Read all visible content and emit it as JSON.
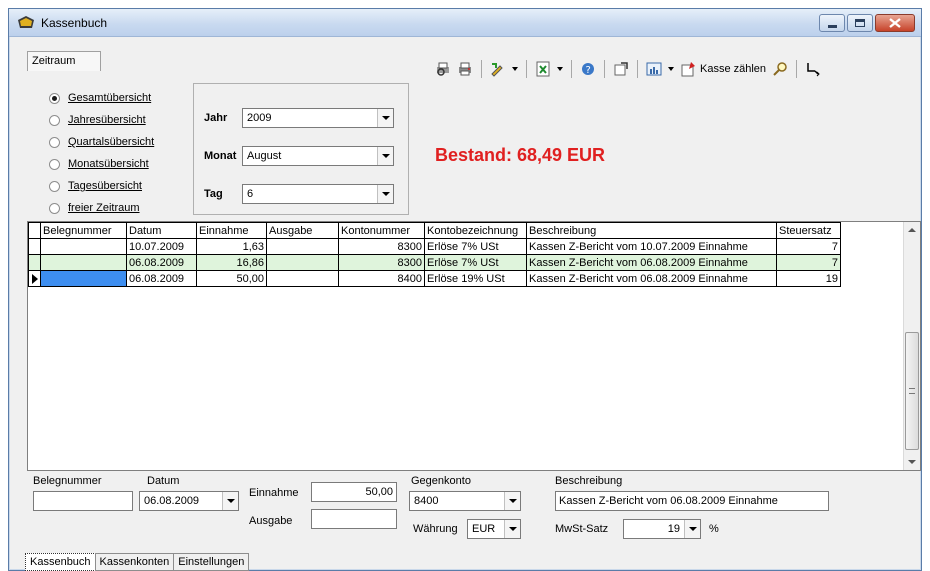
{
  "window": {
    "title": "Kassenbuch"
  },
  "zeitraum_tab": {
    "label": "Zeitraum"
  },
  "overview_options": [
    {
      "label": "Gesamtübersicht",
      "checked": true
    },
    {
      "label": "Jahresübersicht",
      "checked": false
    },
    {
      "label": "Quartalsübersicht",
      "checked": false
    },
    {
      "label": "Monatsübersicht",
      "checked": false
    },
    {
      "label": "Tagesübersicht",
      "checked": false
    },
    {
      "label": "freier Zeitraum",
      "checked": false
    }
  ],
  "selectors": {
    "jahr": {
      "label": "Jahr",
      "value": "2009"
    },
    "monat": {
      "label": "Monat",
      "value": "August"
    },
    "tag": {
      "label": "Tag",
      "value": "6"
    }
  },
  "bestand": {
    "text": "Bestand: 68,49 EUR",
    "color": "#e02020"
  },
  "toolbar": {
    "kasse_zaehlen_label": "Kasse zählen"
  },
  "table": {
    "columns": [
      "Belegnummer",
      "Datum",
      "Einnahme",
      "Ausgabe",
      "Kontonummer",
      "Kontobezeichnung",
      "Beschreibung",
      "Steuersatz"
    ],
    "rows": [
      {
        "belegnummer": "",
        "datum": "10.07.2009",
        "einnahme": "1,63",
        "ausgabe": "",
        "kontonummer": "8300",
        "kontobezeichnung": "Erlöse 7% USt",
        "beschreibung": "Kassen Z-Bericht vom 10.07.2009 Einnahme",
        "steuersatz": "7"
      },
      {
        "belegnummer": "",
        "datum": "06.08.2009",
        "einnahme": "16,86",
        "ausgabe": "",
        "kontonummer": "8300",
        "kontobezeichnung": "Erlöse 7% USt",
        "beschreibung": "Kassen Z-Bericht vom 06.08.2009 Einnahme",
        "steuersatz": "7"
      },
      {
        "belegnummer": "",
        "datum": "06.08.2009",
        "einnahme": "50,00",
        "ausgabe": "",
        "kontonummer": "8400",
        "kontobezeichnung": "Erlöse 19% USt",
        "beschreibung": "Kassen Z-Bericht vom 06.08.2009 Einnahme",
        "steuersatz": "19"
      }
    ]
  },
  "form": {
    "belegnummer": {
      "label": "Belegnummer",
      "value": ""
    },
    "datum": {
      "label": "Datum",
      "value": "06.08.2009"
    },
    "einnahme": {
      "label": "Einnahme",
      "value": "50,00"
    },
    "ausgabe": {
      "label": "Ausgabe",
      "value": ""
    },
    "gegenkonto": {
      "label": "Gegenkonto",
      "value": "8400"
    },
    "waehrung": {
      "label": "Währung",
      "value": "EUR"
    },
    "beschreibung": {
      "label": "Beschreibung",
      "value": "Kassen Z-Bericht vom 06.08.2009 Einnahme"
    },
    "mwst": {
      "label": "MwSt-Satz",
      "value": "19",
      "unit": "%"
    }
  },
  "bottom_tabs": [
    {
      "label": "Kassenbuch",
      "active": true
    },
    {
      "label": "Kassenkonten",
      "active": false
    },
    {
      "label": "Einstellungen",
      "active": false
    }
  ]
}
